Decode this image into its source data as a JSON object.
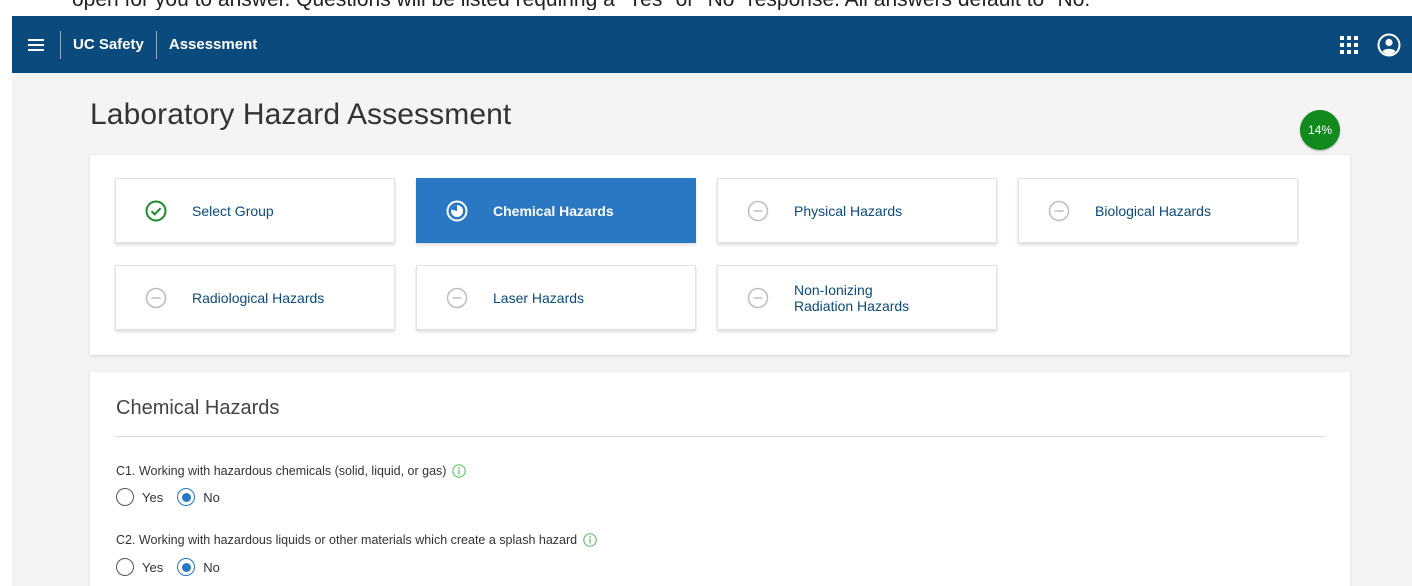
{
  "document_crop_text": "open for you to answer. Questions will be listed requiring a \"Yes\" or \"No\" response. All answers default to \"No.\"",
  "topbar": {
    "brand": "UC Safety",
    "title": "Assessment",
    "background": "#0b4a7d"
  },
  "page": {
    "title": "Laboratory Hazard Assessment",
    "progress": "14%",
    "progress_color": "#138a1d"
  },
  "steps": [
    {
      "label": "Select Group",
      "status": "complete",
      "icon": "check-circle-icon"
    },
    {
      "label": "Chemical Hazards",
      "status": "active",
      "icon": "in-progress-icon"
    },
    {
      "label": "Physical Hazards",
      "status": "pending",
      "icon": "minus-circle-icon"
    },
    {
      "label": "Biological Hazards",
      "status": "pending",
      "icon": "minus-circle-icon"
    },
    {
      "label": "Radiological Hazards",
      "status": "pending",
      "icon": "minus-circle-icon"
    },
    {
      "label": "Laser Hazards",
      "status": "pending",
      "icon": "minus-circle-icon"
    },
    {
      "label_line1": "Non-Ionizing",
      "label_line2": "Radiation Hazards",
      "status": "pending",
      "icon": "minus-circle-icon"
    }
  ],
  "section": {
    "title": "Chemical Hazards",
    "questions": [
      {
        "text": "C1. Working with hazardous chemicals (solid, liquid, or gas)",
        "yes": "Yes",
        "no": "No",
        "selected": "No"
      },
      {
        "text": "C2. Working with hazardous liquids or other materials which create a splash hazard",
        "yes": "Yes",
        "no": "No",
        "selected": "No"
      }
    ]
  },
  "accent": "#2a78c3"
}
